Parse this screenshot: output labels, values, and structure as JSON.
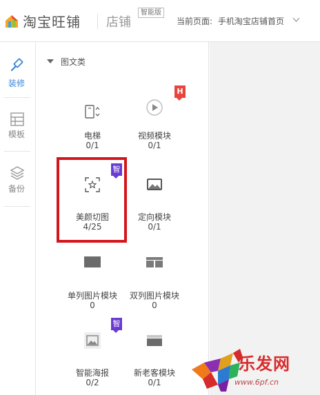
{
  "header": {
    "brand": "淘宝旺铺",
    "shop_label": "店铺",
    "edition_badge": "智能版",
    "current_page_label": "当前页面:",
    "current_page_value": "手机淘宝店铺首页"
  },
  "leftnav": {
    "items": [
      {
        "label": "装修",
        "icon": "brush-icon",
        "active": true
      },
      {
        "label": "模板",
        "icon": "template-icon",
        "active": false
      },
      {
        "label": "备份",
        "icon": "layers-icon",
        "active": false
      }
    ]
  },
  "panel": {
    "section_title": "图文类",
    "modules": [
      {
        "name": "电梯",
        "count": "0/1",
        "icon": "elevator-icon"
      },
      {
        "name": "视频模块",
        "count": "0/1",
        "icon": "play-icon",
        "tag": "H"
      },
      {
        "name": "美颜切图",
        "count": "4/25",
        "icon": "crop-icon",
        "tag": "智"
      },
      {
        "name": "定向模块",
        "count": "0/1",
        "icon": "image-icon"
      },
      {
        "name": "单列图片模块",
        "count": "0",
        "icon": "single-image-icon"
      },
      {
        "name": "双列图片模块",
        "count": "0",
        "icon": "double-image-icon"
      },
      {
        "name": "智能海报",
        "count": "0/2",
        "icon": "poster-icon",
        "tag": "智"
      },
      {
        "name": "新老客模块",
        "count": "0/1",
        "icon": "customer-icon"
      }
    ]
  },
  "watermark": {
    "title": "乐发网",
    "url": "www.6pf.cn"
  },
  "colors": {
    "active": "#ff5000",
    "highlight_border": "#d4151c",
    "tag_h": "#e8453c",
    "tag_smart": "#6a3bd1"
  }
}
